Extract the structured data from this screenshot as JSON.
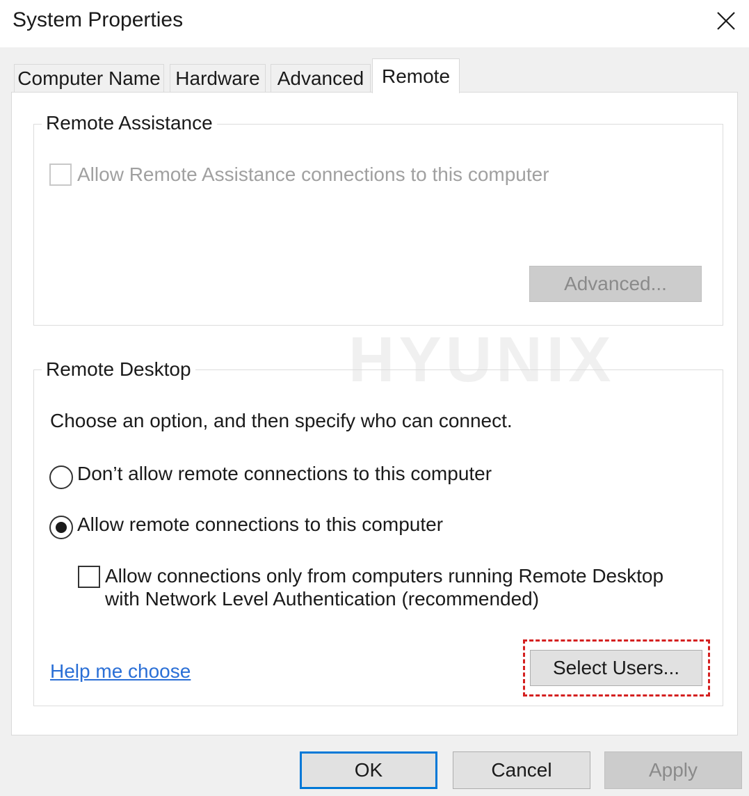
{
  "window": {
    "title": "System Properties",
    "close_icon": "close-icon"
  },
  "tabs": [
    {
      "label": "Computer Name",
      "active": false
    },
    {
      "label": "Hardware",
      "active": false
    },
    {
      "label": "Advanced",
      "active": false
    },
    {
      "label": "Remote",
      "active": true
    }
  ],
  "remote_assistance": {
    "group_label": "Remote Assistance",
    "allow_checkbox_label": "Allow Remote Assistance connections to this computer",
    "allow_checked": false,
    "allow_enabled": false,
    "advanced_button": "Advanced..."
  },
  "remote_desktop": {
    "group_label": "Remote Desktop",
    "instruction": "Choose an option, and then specify who can connect.",
    "options": [
      {
        "label": "Don’t allow remote connections to this computer",
        "selected": false
      },
      {
        "label": "Allow remote connections to this computer",
        "selected": true
      }
    ],
    "nla_checkbox_line1": "Allow connections only from computers running Remote Desktop",
    "nla_checkbox_line2": "with Network Level Authentication (recommended)",
    "nla_checked": false,
    "help_link": "Help me choose",
    "select_users_button": "Select Users..."
  },
  "footer": {
    "ok": "OK",
    "cancel": "Cancel",
    "apply": "Apply"
  },
  "watermark": "HYUNIX",
  "colors": {
    "accent": "#0078d7",
    "highlight": "#d42020",
    "link": "#2a6fd6",
    "dialog_bg": "#f0f0f0"
  }
}
